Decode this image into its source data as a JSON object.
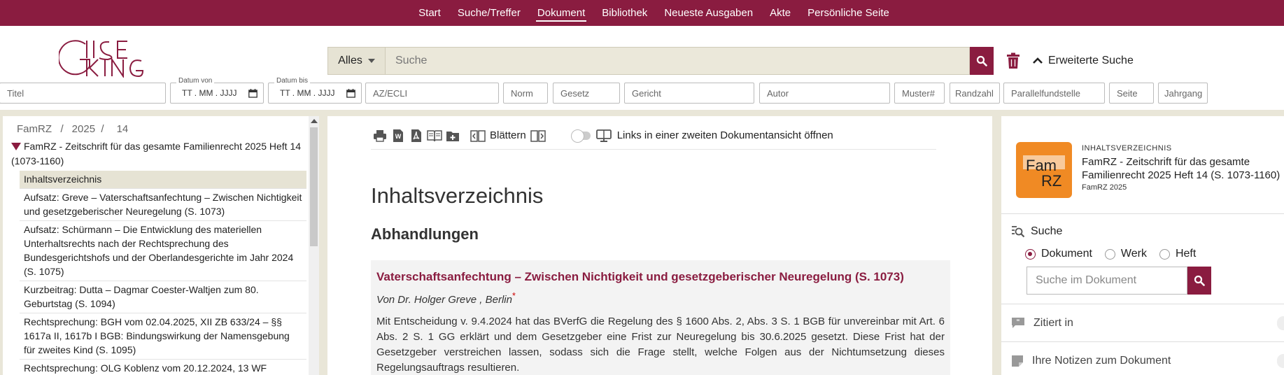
{
  "nav": {
    "items": [
      "Start",
      "Suche/Treffer",
      "Dokument",
      "Bibliothek",
      "Neueste Ausgaben",
      "Akte",
      "Persönliche Seite"
    ],
    "active": "Dokument"
  },
  "search": {
    "scope": "Alles",
    "placeholder": "Suche",
    "advanced_label": "Erweiterte Suche"
  },
  "filters": {
    "titel": "Titel",
    "datum_von_label": "Datum von",
    "datum_von_value": "TT . MM . JJJJ",
    "datum_bis_label": "Datum bis",
    "datum_bis_value": "TT . MM . JJJJ",
    "az": "AZ/ECLI",
    "norm": "Norm",
    "gesetz": "Gesetz",
    "gericht": "Gericht",
    "autor": "Autor",
    "muster": "Muster#",
    "randzahl": "Randzahl",
    "parallel": "Parallelfundstelle",
    "seite": "Seite",
    "jahrgang": "Jahrgang"
  },
  "breadcrumb": [
    "FamRZ",
    "2025",
    "14"
  ],
  "tree": {
    "root": "FamRZ - Zeitschrift für das gesamte Familienrecht 2025 Heft 14 (1073-1160)",
    "items": [
      "Inhaltsverzeichnis",
      "Aufsatz: Greve – Vaterschaftsanfechtung – Zwischen Nichtigkeit und gesetzgeberischer Neuregelung (S. 1073)",
      "Aufsatz: Schürmann – Die Entwicklung des materiellen Unterhaltsrechts nach der Rechtsprechung des Bundesgerichtshofs und der Oberlandesgerichte im Jahr 2024 (S. 1075)",
      "Kurzbeitrag: Dutta – Dagmar Coester-Waltjen zum 80. Geburtstag (S. 1094)",
      "Rechtsprechung: BGH vom 02.04.2025, XII ZB 633/24 – §§ 1617a II, 1617b I BGB: Bindungswirkung der Namensgebung für zweites Kind (S. 1095)",
      "Rechtsprechung: OLG Koblenz vom 20.12.2024, 13 WF"
    ],
    "active_index": 0
  },
  "doc": {
    "toolbar": {
      "blaettern": "Blättern",
      "links_label": "Links in einer zweiten Dokumentansicht öffnen"
    },
    "title": "Inhaltsverzeichnis",
    "section": "Abhandlungen",
    "article": {
      "title": "Vaterschaftsanfechtung – Zwischen Nichtigkeit und gesetzgeberischer Neuregelung (S. 1073)",
      "author": "Von Dr. Holger  Greve , Berlin",
      "author_mark": "*",
      "text": "Mit Entscheidung v. 9.4.2024 hat das BVerfG die Regelung des § 1600 Abs. 2, Abs. 3 S. 1 BGB für unvereinbar mit Art. 6 Abs. 2 S. 1 GG erklärt und dem Gesetzgeber eine Frist zur Neuregelung bis 30.6.2025 gesetzt. Diese Frist hat der Gesetzgeber verstreichen lassen, sodass sich die Frage stellt, welche Folgen aus der Nichtumsetzung dieses Regelungsauftrags resultieren."
    }
  },
  "right": {
    "logo_text_top": "Fam",
    "logo_text_bottom": "RZ",
    "kicker": "INHALTSVERZEICHNIS",
    "title": "FamRZ - Zeitschrift für das gesamte Familienrecht 2025 Heft 14 (S. 1073-1160)",
    "subtitle": "FamRZ 2025",
    "search_label": "Suche",
    "radios": [
      "Dokument",
      "Werk",
      "Heft"
    ],
    "radio_selected": 0,
    "search_placeholder": "Suche im Dokument",
    "zitiert": "Zitiert in",
    "notizen": "Ihre Notizen zum Dokument"
  },
  "colors": {
    "brand": "#8a1c40",
    "beige": "#e9e6d8",
    "orange": "#f08a24"
  }
}
